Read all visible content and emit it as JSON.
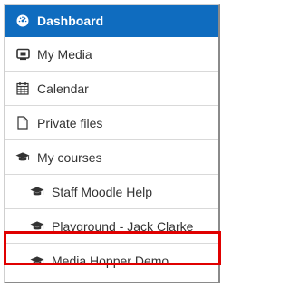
{
  "nav": {
    "dashboard": {
      "label": "Dashboard",
      "icon": "tachometer-icon"
    },
    "items": [
      {
        "label": "My Media",
        "icon": "media-icon"
      },
      {
        "label": "Calendar",
        "icon": "calendar-icon"
      },
      {
        "label": "Private files",
        "icon": "file-icon"
      },
      {
        "label": "My courses",
        "icon": "graduation-cap-icon"
      },
      {
        "label": "Staff Moodle Help",
        "icon": "graduation-cap-icon"
      },
      {
        "label": "Playground - Jack Clarke",
        "icon": "graduation-cap-icon"
      },
      {
        "label": "Media Hopper Demo",
        "icon": "graduation-cap-icon"
      }
    ]
  },
  "colors": {
    "accent": "#0f6cbf",
    "highlight": "#e00000",
    "text": "#333333"
  }
}
